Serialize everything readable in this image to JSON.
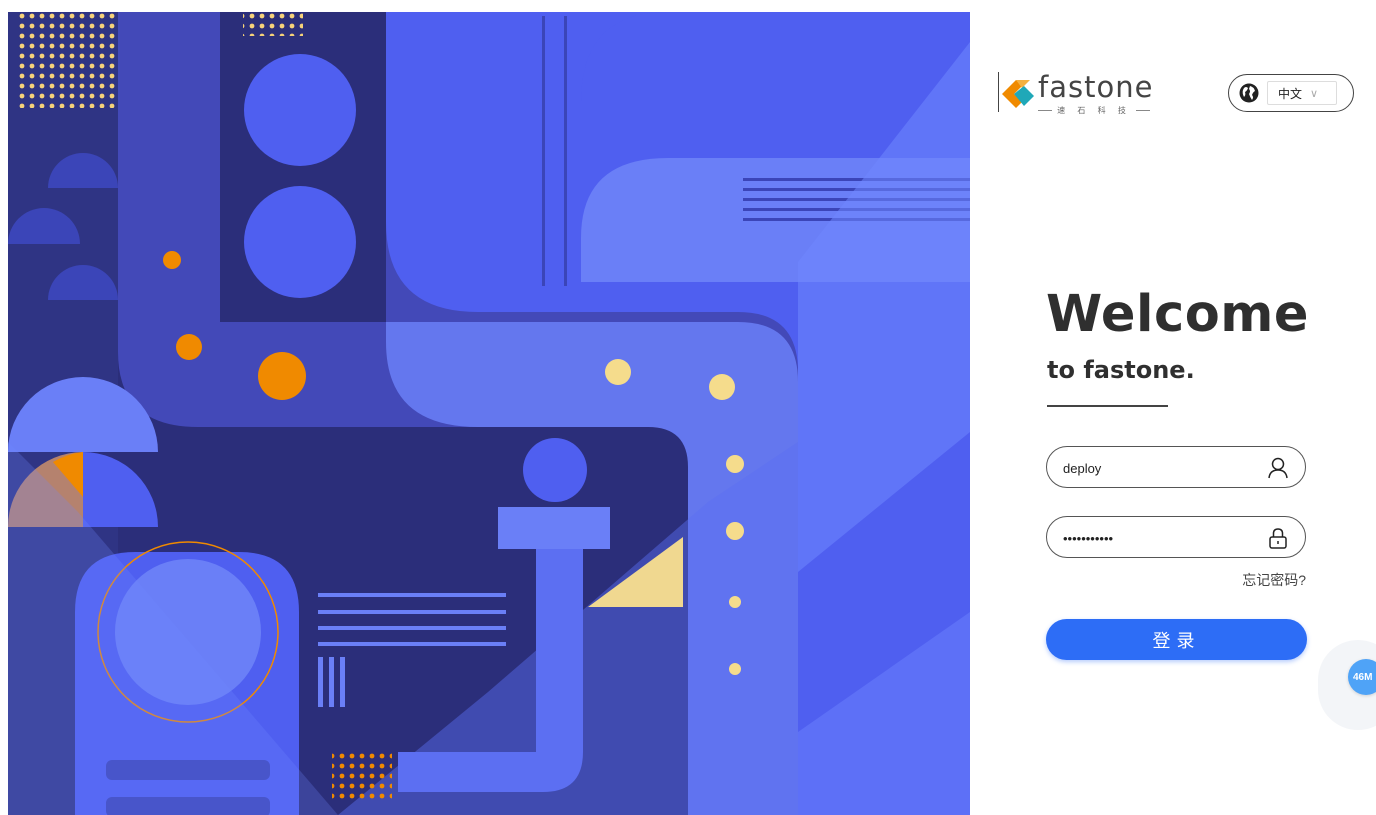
{
  "logo": {
    "name": "fastone",
    "subtitle": "速 石 科 技"
  },
  "language": {
    "selected": "中文"
  },
  "heading": {
    "title": "Welcome",
    "subtitle": "to fastone."
  },
  "form": {
    "username": "deploy",
    "password": "•••••••••••",
    "forgot_label": "忘记密码?",
    "login_label": "登录"
  },
  "floating": {
    "badge": "46M"
  },
  "colors": {
    "primary_button": "#2d6df6",
    "illustration_bg": "#2b2e7a",
    "illustration_blue": "#4f5ff0",
    "accent_orange": "#f08a00",
    "accent_yellow": "#f5dc8c",
    "badge_blue": "#4fa3f7"
  },
  "icons": {
    "globe": "globe-icon",
    "user": "user-icon",
    "lock": "lock-icon",
    "chevron": "chevron-down-icon"
  }
}
